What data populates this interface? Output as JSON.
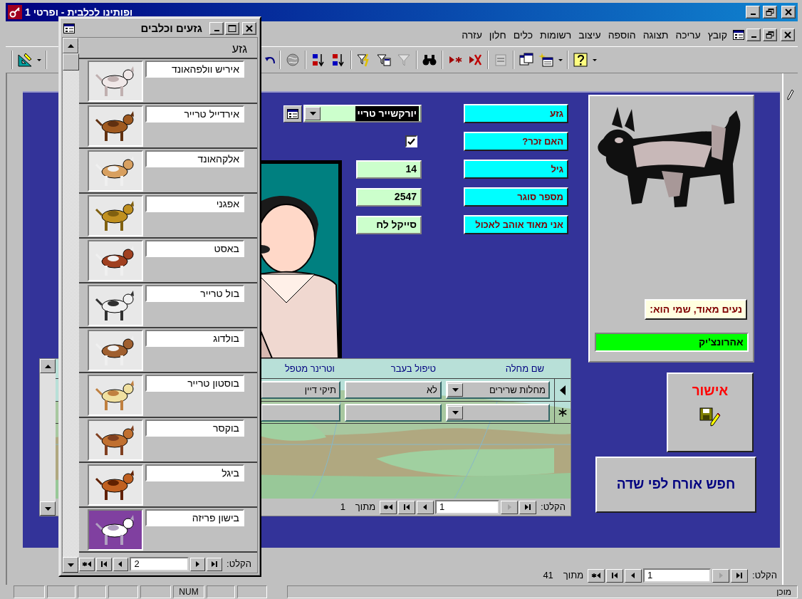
{
  "window": {
    "title": "ופותינו לכלבית - ופרטי 1"
  },
  "menu": [
    {
      "label": "קובץ"
    },
    {
      "label": "עריכה"
    },
    {
      "label": "תצוגה"
    },
    {
      "label": "הוספה"
    },
    {
      "label": "עיצוב"
    },
    {
      "label": "רשומות"
    },
    {
      "label": "כלים"
    },
    {
      "label": "חלון"
    },
    {
      "label": "עזרה"
    }
  ],
  "form": {
    "fields": [
      {
        "label": "גזע",
        "kind": "combo",
        "value": "יורקשייר טריי",
        "selected": true
      },
      {
        "label": "האם זכר?",
        "kind": "checkbox",
        "checked": true
      },
      {
        "label": "גיל",
        "kind": "text",
        "value": "14"
      },
      {
        "label": "מספר סוגר",
        "kind": "text",
        "value": "2547"
      },
      {
        "label": "אני מאוד אוהב לאכול",
        "kind": "text",
        "value": "סייקל לח"
      }
    ],
    "greeting": "נעים מאוד, שמי הוא:",
    "dog_name": "אהרונצ'יק",
    "approve_button": "אישור",
    "search_button": "חפש אורח לפי שדה"
  },
  "subform": {
    "columns": [
      {
        "title": "שם מחלה",
        "kind": "combo"
      },
      {
        "title": "טיפול בעבר",
        "kind": "text"
      },
      {
        "title": "וטרינר מטפל",
        "kind": "text"
      }
    ],
    "rows": [
      {
        "kind": "current",
        "cells": [
          "מחלות שרירים",
          "לא",
          "תיקי דיין"
        ]
      },
      {
        "kind": "new"
      }
    ],
    "navigation": {
      "label": "הקלט:",
      "record": "1",
      "previous_disabled": true,
      "of_label": "מתוך",
      "total": "1"
    }
  },
  "breeds_window": {
    "title": "גזעים וכלבים",
    "column": "גזע",
    "rows": [
      {
        "name": "איריש וולפהאונד"
      },
      {
        "name": "אירדייל טרייר"
      },
      {
        "name": "אלקהאונד"
      },
      {
        "name": "אפגני"
      },
      {
        "name": "באסט"
      },
      {
        "name": "בול טרייר"
      },
      {
        "name": "בולדוג"
      },
      {
        "name": "בוסטון טרייר"
      },
      {
        "name": "בוקסר"
      },
      {
        "name": "ביגל"
      },
      {
        "name": "בישון פריזה"
      }
    ],
    "navigation": {
      "label": "הקלט:",
      "record": "2",
      "previous_disabled": false
    }
  },
  "navigation": {
    "label": "הקלט:",
    "record": "1",
    "previous_disabled": true,
    "of_label": "מתוך",
    "total": "41"
  },
  "status_bar": {
    "indicators": [
      "NUM"
    ],
    "text": "מוכן"
  }
}
